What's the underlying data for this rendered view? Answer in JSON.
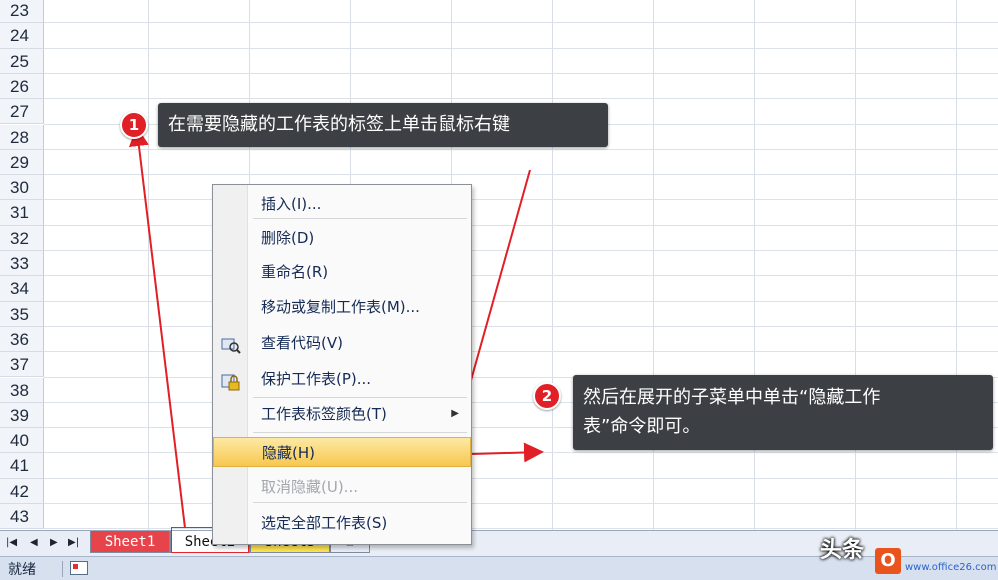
{
  "rows": [
    "23",
    "24",
    "25",
    "26",
    "27",
    "28",
    "29",
    "30",
    "31",
    "32",
    "33",
    "34",
    "35",
    "36",
    "37",
    "38",
    "39",
    "40",
    "41",
    "42",
    "43"
  ],
  "tabs": [
    "Sheet1",
    "Sheet2",
    "Sheet3"
  ],
  "status": "就绪",
  "menu": {
    "items": [
      {
        "label": "插入(I)...",
        "icon": "",
        "disabled": false,
        "submenu": false,
        "highlight": false
      },
      {
        "label": "删除(D)",
        "icon": "",
        "disabled": false,
        "submenu": false,
        "highlight": false
      },
      {
        "label": "重命名(R)",
        "icon": "",
        "disabled": false,
        "submenu": false,
        "highlight": false
      },
      {
        "label": "移动或复制工作表(M)...",
        "icon": "",
        "disabled": false,
        "submenu": false,
        "highlight": false
      },
      {
        "label": "查看代码(V)",
        "icon": "view-code-icon",
        "disabled": false,
        "submenu": false,
        "highlight": false
      },
      {
        "label": "保护工作表(P)...",
        "icon": "lock-icon",
        "disabled": false,
        "submenu": false,
        "highlight": false
      },
      {
        "label": "工作表标签颜色(T)",
        "icon": "",
        "disabled": false,
        "submenu": true,
        "highlight": false
      },
      {
        "label": "隐藏(H)",
        "icon": "",
        "disabled": false,
        "submenu": false,
        "highlight": true
      },
      {
        "label": "取消隐藏(U)...",
        "icon": "",
        "disabled": true,
        "submenu": false,
        "highlight": false
      },
      {
        "label": "选定全部工作表(S)",
        "icon": "",
        "disabled": false,
        "submenu": false,
        "highlight": false
      }
    ]
  },
  "callout1": {
    "num": "1",
    "text": "在需要隐藏的工作表的标签上单击鼠标右键"
  },
  "callout2": {
    "num": "2",
    "line1": "然后在展开的子菜单中单击“隐藏工作",
    "line2": "表”命令即可。"
  },
  "watermark": "头条",
  "site": "www.office26.com",
  "colors": {
    "accent": "#e11f26",
    "highlight": "#f7c74f",
    "callout": "#3c3f43"
  }
}
